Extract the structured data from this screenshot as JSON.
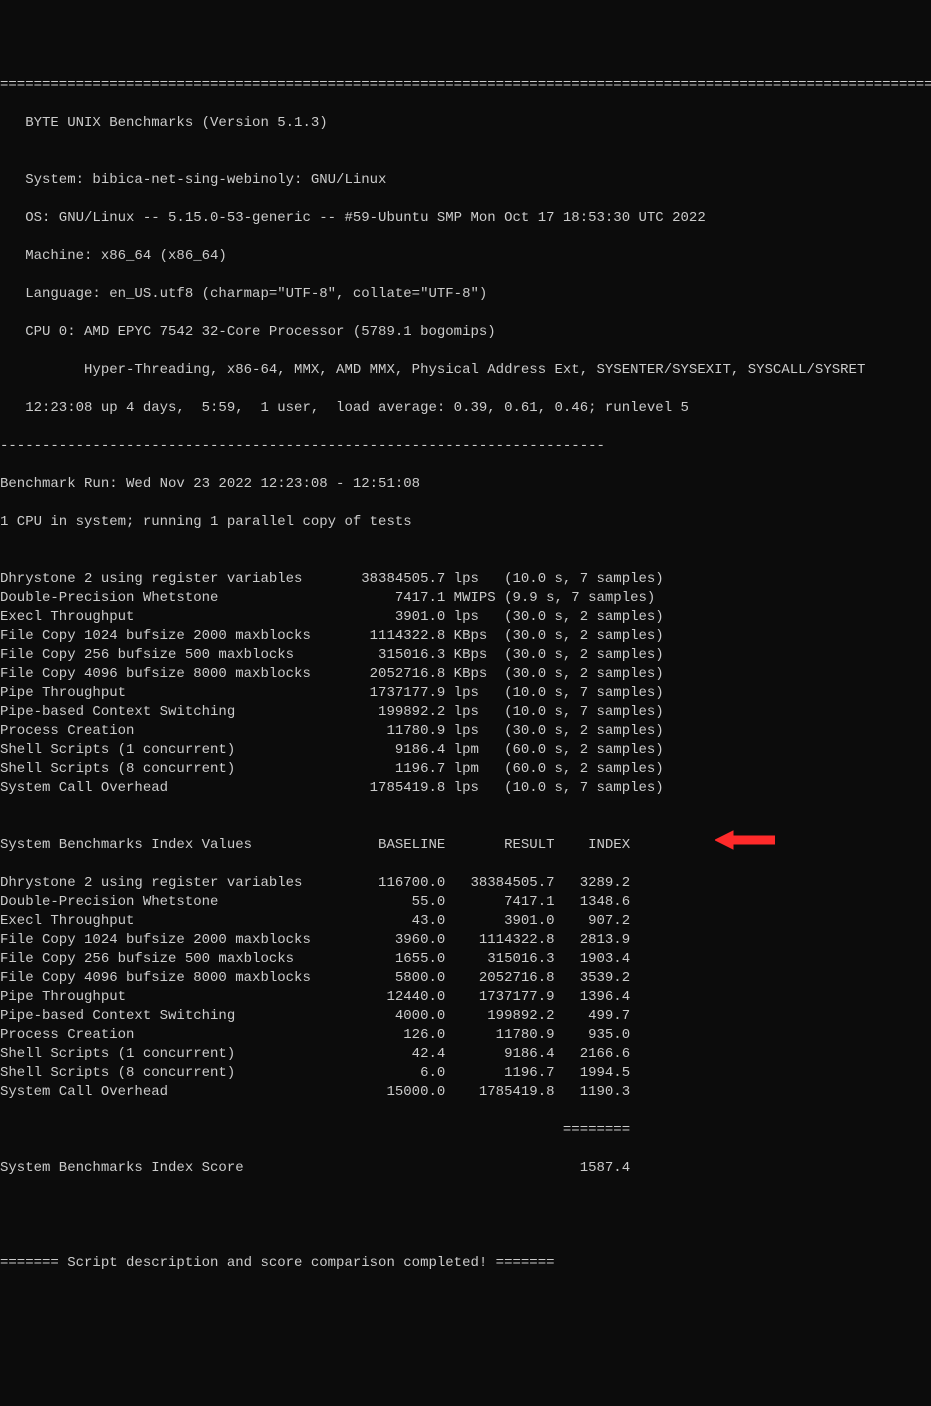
{
  "header_divider": "========================================================================================================================",
  "title": "   BYTE UNIX Benchmarks (Version 5.1.3)",
  "blank": "",
  "system_line": "   System: bibica-net-sing-webinoly: GNU/Linux",
  "os_line": "   OS: GNU/Linux -- 5.15.0-53-generic -- #59-Ubuntu SMP Mon Oct 17 18:53:30 UTC 2022",
  "machine_line": "   Machine: x86_64 (x86_64)",
  "language_line": "   Language: en_US.utf8 (charmap=\"UTF-8\", collate=\"UTF-8\")",
  "cpu_line": "   CPU 0: AMD EPYC 7542 32-Core Processor (5789.1 bogomips)",
  "cpu_features": "          Hyper-Threading, x86-64, MMX, AMD MMX, Physical Address Ext, SYSENTER/SYSEXIT, SYSCALL/SYSRET",
  "uptime_line": "   12:23:08 up 4 days,  5:59,  1 user,  load average: 0.39, 0.61, 0.46; runlevel 5",
  "divider_dash": "------------------------------------------------------------------------",
  "run_line": "Benchmark Run: Wed Nov 23 2022 12:23:08 - 12:51:08",
  "cpu_count_line": "1 CPU in system; running 1 parallel copy of tests",
  "results": [
    "Dhrystone 2 using register variables       38384505.7 lps   (10.0 s, 7 samples)",
    "Double-Precision Whetstone                     7417.1 MWIPS (9.9 s, 7 samples)",
    "Execl Throughput                               3901.0 lps   (30.0 s, 2 samples)",
    "File Copy 1024 bufsize 2000 maxblocks       1114322.8 KBps  (30.0 s, 2 samples)",
    "File Copy 256 bufsize 500 maxblocks          315016.3 KBps  (30.0 s, 2 samples)",
    "File Copy 4096 bufsize 8000 maxblocks       2052716.8 KBps  (30.0 s, 2 samples)",
    "Pipe Throughput                             1737177.9 lps   (10.0 s, 7 samples)",
    "Pipe-based Context Switching                 199892.2 lps   (10.0 s, 7 samples)",
    "Process Creation                              11780.9 lps   (30.0 s, 2 samples)",
    "Shell Scripts (1 concurrent)                   9186.4 lpm   (60.0 s, 2 samples)",
    "Shell Scripts (8 concurrent)                   1196.7 lpm   (60.0 s, 2 samples)",
    "System Call Overhead                        1785419.8 lps   (10.0 s, 7 samples)"
  ],
  "index_header": "System Benchmarks Index Values               BASELINE       RESULT    INDEX",
  "index_rows": [
    "Dhrystone 2 using register variables         116700.0   38384505.7   3289.2",
    "Double-Precision Whetstone                       55.0       7417.1   1348.6",
    "Execl Throughput                                 43.0       3901.0    907.2",
    "File Copy 1024 bufsize 2000 maxblocks          3960.0    1114322.8   2813.9",
    "File Copy 256 bufsize 500 maxblocks            1655.0     315016.3   1903.4",
    "File Copy 4096 bufsize 8000 maxblocks          5800.0    2052716.8   3539.2",
    "Pipe Throughput                               12440.0    1737177.9   1396.4",
    "Pipe-based Context Switching                   4000.0     199892.2    499.7",
    "Process Creation                                126.0      11780.9    935.0",
    "Shell Scripts (1 concurrent)                     42.4       9186.4   2166.6",
    "Shell Scripts (8 concurrent)                      6.0       1196.7   1994.5",
    "System Call Overhead                          15000.0    1785419.8   1190.3"
  ],
  "score_divider": "                                                                   ========",
  "score_line": "System Benchmarks Index Score                                        1587.4",
  "footer": "======= Script description and score comparison completed! ======="
}
